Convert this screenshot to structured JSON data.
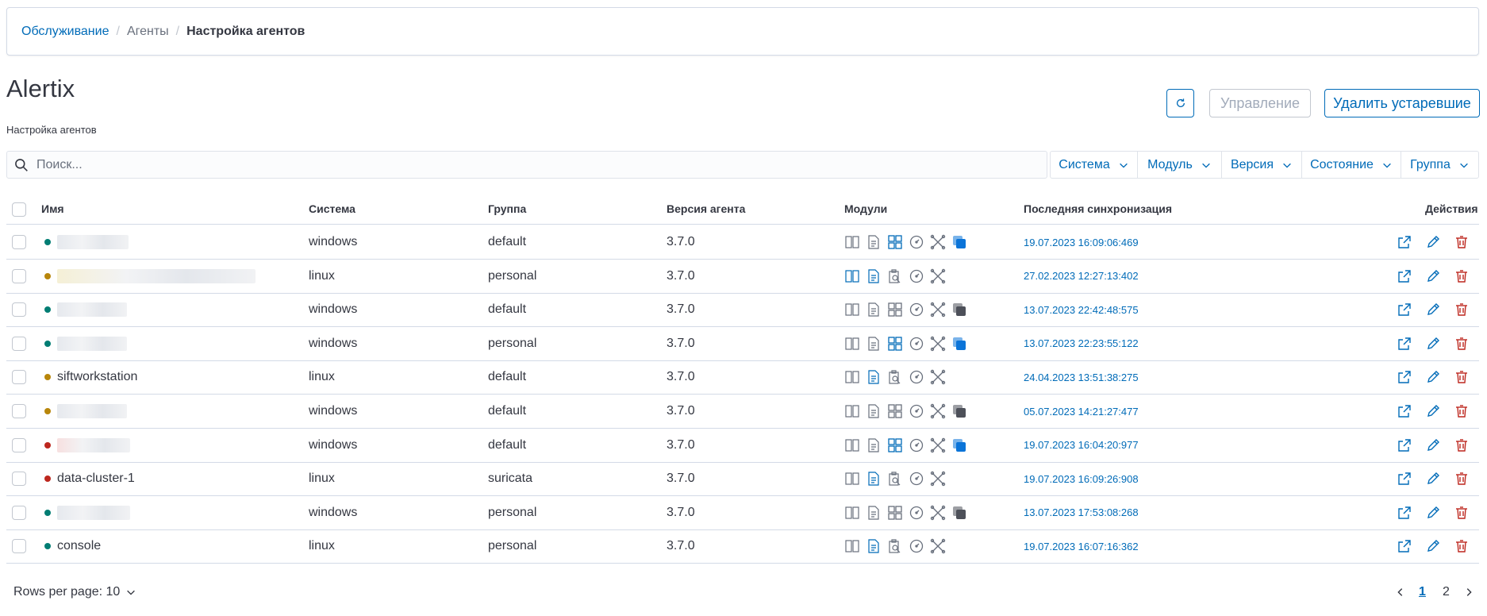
{
  "breadcrumb": {
    "link": "Обслуживание",
    "mid": "Агенты",
    "current": "Настройка агентов"
  },
  "header": {
    "title": "Alertix",
    "subtitle": "Настройка агентов"
  },
  "toolbar": {
    "manage_label": "Управление",
    "delete_label": "Удалить устаревшие"
  },
  "search": {
    "placeholder": "Поиск..."
  },
  "filters": [
    "Система",
    "Модуль",
    "Версия",
    "Состояние",
    "Группа"
  ],
  "table": {
    "columns": {
      "name": "Имя",
      "system": "Система",
      "group": "Группа",
      "version": "Версия агента",
      "modules": "Модули",
      "sync": "Последняя синхронизация",
      "actions": "Действия"
    },
    "rows": [
      {
        "name": "",
        "status": "active",
        "system": "windows",
        "group": "default",
        "version": "3.7.0",
        "modules": "win-active",
        "sync": "19.07.2023 16:09:06:469"
      },
      {
        "name": "",
        "status": "warning",
        "system": "linux",
        "group": "personal",
        "version": "3.7.0",
        "modules": "lin-a",
        "sync": "27.02.2023 12:27:13:402"
      },
      {
        "name": "",
        "status": "active",
        "system": "windows",
        "group": "default",
        "version": "3.7.0",
        "modules": "win-inactive",
        "sync": "13.07.2023 22:42:48:575"
      },
      {
        "name": "",
        "status": "active",
        "system": "windows",
        "group": "personal",
        "version": "3.7.0",
        "modules": "win-active",
        "sync": "13.07.2023 22:23:55:122"
      },
      {
        "name": "siftworkstation",
        "status": "warning",
        "system": "linux",
        "group": "default",
        "version": "3.7.0",
        "modules": "lin-b",
        "sync": "24.04.2023 13:51:38:275"
      },
      {
        "name": "",
        "status": "warning",
        "system": "windows",
        "group": "default",
        "version": "3.7.0",
        "modules": "win-inactive",
        "sync": "05.07.2023 14:21:27:477"
      },
      {
        "name": "",
        "status": "error",
        "system": "windows",
        "group": "default",
        "version": "3.7.0",
        "modules": "win-active",
        "sync": "19.07.2023 16:04:20:977"
      },
      {
        "name": "data-cluster-1",
        "status": "error",
        "system": "linux",
        "group": "suricata",
        "version": "3.7.0",
        "modules": "lin-b",
        "sync": "19.07.2023 16:09:26:908"
      },
      {
        "name": "",
        "status": "active",
        "system": "windows",
        "group": "personal",
        "version": "3.7.0",
        "modules": "win-inactive",
        "sync": "13.07.2023 17:53:08:268"
      },
      {
        "name": "console",
        "status": "active",
        "system": "linux",
        "group": "personal",
        "version": "3.7.0",
        "modules": "lin-b",
        "sync": "19.07.2023 16:07:16:362"
      }
    ]
  },
  "pagination": {
    "rows_per_page": "Rows per page: 10",
    "current_page": "1",
    "next_page": "2"
  },
  "colors": {
    "accent": "#006bb8",
    "active": "#017d73",
    "warning": "#b8860b",
    "error": "#bd271e",
    "muted": "#69707d"
  }
}
